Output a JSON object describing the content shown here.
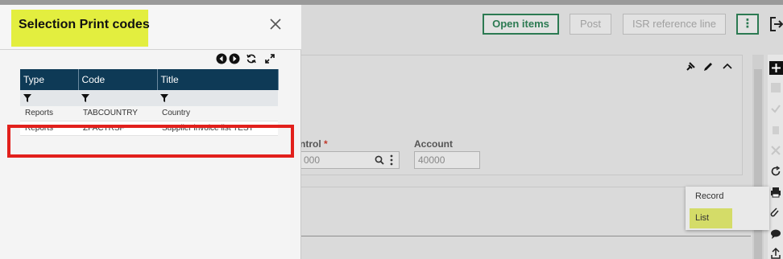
{
  "dialog": {
    "title": "Selection Print codes",
    "columns": [
      "Type",
      "Code",
      "Title"
    ],
    "rows": [
      {
        "type": "Reports",
        "code": "TABCOUNTRY",
        "title": "Country"
      },
      {
        "type": "Reports",
        "code": "ZFACTRSF",
        "title": "Supplier invoice list TEST"
      }
    ],
    "icons": [
      "previous-icon",
      "next-icon",
      "refresh-icon",
      "expand-icon",
      "close-icon",
      "filter-icon"
    ]
  },
  "toolbar": {
    "open_items": "Open items",
    "post": "Post",
    "isr_reference_line": "ISR reference line",
    "more": "⋮"
  },
  "form": {
    "control_label": "ntrol",
    "control_required": "*",
    "control_value": "000",
    "account_label": "Account",
    "account_value": "40000"
  },
  "context_menu": {
    "items": [
      "Record",
      "List"
    ],
    "highlighted": "List"
  },
  "colors": {
    "grid_header": "#0e3a56",
    "title_highlight": "#e3ee3f",
    "annotation": "#e2201c",
    "accent_green": "#2c7a52"
  }
}
